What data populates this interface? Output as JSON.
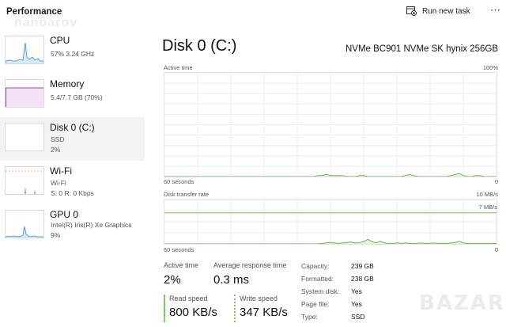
{
  "header": {
    "title": "Performance",
    "watermark": "nanbarov",
    "run_task_label": "Run new task",
    "more_icon": "more-icon"
  },
  "sidebar": {
    "items": [
      {
        "name": "CPU",
        "line1": "57%  3.24 GHz",
        "line2": "",
        "selected": false,
        "graph_color": "#2c8fd4",
        "thumb_icon": "cpu-graph"
      },
      {
        "name": "Memory",
        "line1": "5.4/7.7 GB (70%)",
        "line2": "",
        "selected": false,
        "graph_color": "#9b3fa8",
        "thumb_icon": "memory-graph"
      },
      {
        "name": "Disk 0 (C:)",
        "line1": "SSD",
        "line2": "2%",
        "selected": true,
        "graph_color": "#66b83c",
        "thumb_icon": "disk-graph"
      },
      {
        "name": "Wi-Fi",
        "line1": "Wi-Fi",
        "line2": "S: 0  R: 0 Kbps",
        "selected": false,
        "graph_color": "#c86a1c",
        "thumb_icon": "wifi-graph"
      },
      {
        "name": "GPU 0",
        "line1": "Intel(R) Iris(R) Xe Graphics",
        "line2": "9%",
        "selected": false,
        "graph_color": "#2c8fd4",
        "thumb_icon": "gpu-graph"
      }
    ]
  },
  "main": {
    "title": "Disk 0 (C:)",
    "model": "NVMe BC901 NVMe SK hynix 256GB",
    "active_graph": {
      "label": "Active time",
      "max_label": "100%",
      "time_label": "60 seconds",
      "min_label": "0",
      "values_percent": [
        0,
        0,
        0,
        0,
        0,
        0,
        0,
        0,
        0,
        0,
        0,
        0,
        0,
        0,
        0,
        0,
        0,
        0,
        0,
        0,
        0,
        0,
        0,
        0,
        0,
        0,
        0,
        0,
        0,
        0,
        0,
        0,
        0,
        0,
        0,
        0,
        0,
        1,
        1,
        2,
        1,
        1,
        1,
        1,
        0,
        0,
        0,
        1,
        1,
        0,
        0,
        0,
        0,
        0,
        0,
        0,
        0,
        0,
        1,
        2,
        1,
        0,
        0,
        0,
        0,
        0,
        0,
        0,
        0,
        1,
        2,
        3,
        1,
        0,
        0,
        1,
        1,
        0,
        0,
        0,
        0
      ]
    },
    "transfer_graph": {
      "label": "Disk transfer rate",
      "max_label": "10 MB/s",
      "secondary_label": "7 MB/s",
      "secondary_value_mb": 7,
      "max_value_mb": 10,
      "time_label": "60 seconds",
      "min_label": "0",
      "values_mb": [
        0,
        0,
        0,
        0,
        0,
        0,
        0,
        0,
        0,
        0,
        0,
        0,
        0,
        0,
        0,
        0,
        0,
        0,
        0,
        0,
        0,
        0,
        0,
        0,
        0,
        0,
        0,
        0,
        0,
        0,
        0,
        0,
        0,
        0,
        0,
        0,
        0,
        0,
        0.1,
        0.2,
        0.3,
        0.2,
        0.1,
        0.2,
        0.3,
        0.4,
        0.2,
        0.3,
        0.5,
        1.0,
        0.5,
        0.2,
        0.6,
        0.2,
        0.1,
        0.1,
        0.2,
        0.1,
        0.2,
        0.1,
        0.1,
        0.1,
        0.2,
        0.1,
        0.1,
        0.2,
        0.1,
        0.1,
        0.1,
        0.2,
        0.3,
        0.6,
        0.2,
        0.1,
        0.1,
        0.1,
        0.1,
        0.1,
        0.1,
        0.1,
        0.1
      ]
    },
    "stats": {
      "active_time": {
        "label": "Active time",
        "value": "2%"
      },
      "avg_response": {
        "label": "Average response time",
        "value": "0.3 ms"
      },
      "read_speed": {
        "label": "Read speed",
        "value": "800 KB/s"
      },
      "write_speed": {
        "label": "Write speed",
        "value": "347 KB/s"
      }
    },
    "properties": [
      {
        "key": "Capacity:",
        "value": "239 GB"
      },
      {
        "key": "Formatted:",
        "value": "238 GB"
      },
      {
        "key": "System disk:",
        "value": "Yes"
      },
      {
        "key": "Page file:",
        "value": "Yes"
      },
      {
        "key": "Type:",
        "value": "SSD"
      }
    ]
  },
  "watermark_bazar": "BAZAR",
  "colors": {
    "accent_green": "#66b83c",
    "grid": "#e6e6e6",
    "selected_bg": "#f3f3f3"
  }
}
